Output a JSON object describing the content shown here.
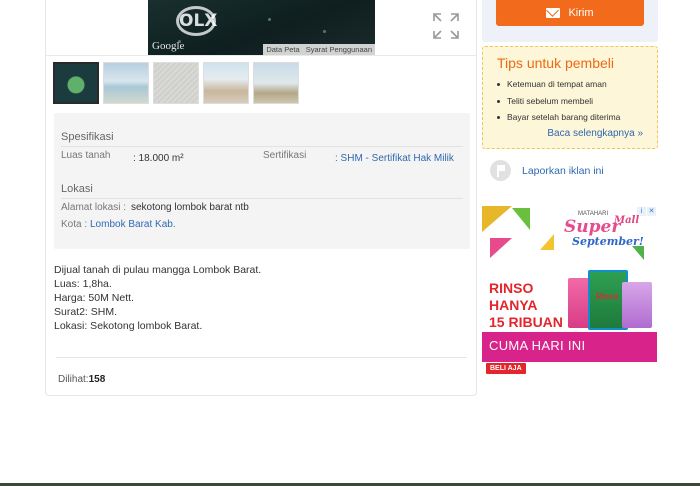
{
  "map": {
    "watermark": "OLX",
    "google_label": "Google",
    "links": [
      "Data Peta",
      "Syarat Penggunaan"
    ]
  },
  "thumbnails": [
    "thumb-1",
    "thumb-2",
    "thumb-3",
    "thumb-4",
    "thumb-5"
  ],
  "specs": {
    "title": "Spesifikasi",
    "area_label": "Luas tanah",
    "area_value": ": 18.000 m²",
    "cert_label": "Sertifikasi",
    "cert_value": ": SHM - Sertifikat Hak Milik"
  },
  "location": {
    "title": "Lokasi",
    "address_label": "Alamat lokasi :",
    "address_value": "sekotong lombok barat ntb",
    "city_label": "Kota :",
    "city_value": "Lombok Barat Kab."
  },
  "description": [
    "Dijual tanah di pulau mangga Lombok Barat.",
    "Luas: 1,8ha.",
    "Harga: 50M Nett.",
    "Surat2: SHM.",
    "Lokasi: Sekotong lombok Barat."
  ],
  "views": {
    "label": "Dilihat:",
    "count": "158"
  },
  "contact": {
    "send_label": "Kirim"
  },
  "tips": {
    "title": "Tips untuk pembeli",
    "items": [
      "Ketemuan di tempat aman",
      "Teliti sebelum membeli",
      "Bayar setelah barang diterima"
    ],
    "read_more": "Baca selengkapnya »"
  },
  "report": {
    "label": "Laporkan iklan ini"
  },
  "ad": {
    "brand_small": "MATAHARI",
    "brand_mall": "Mall",
    "brand_super": "Super",
    "brand_sept": "September!",
    "headline": [
      "RINSO",
      "HANYA",
      "15 RIBUAN"
    ],
    "strip_text": "CUMA HARI INI",
    "cta": "BELI AJA",
    "product_label": "Rinso"
  }
}
